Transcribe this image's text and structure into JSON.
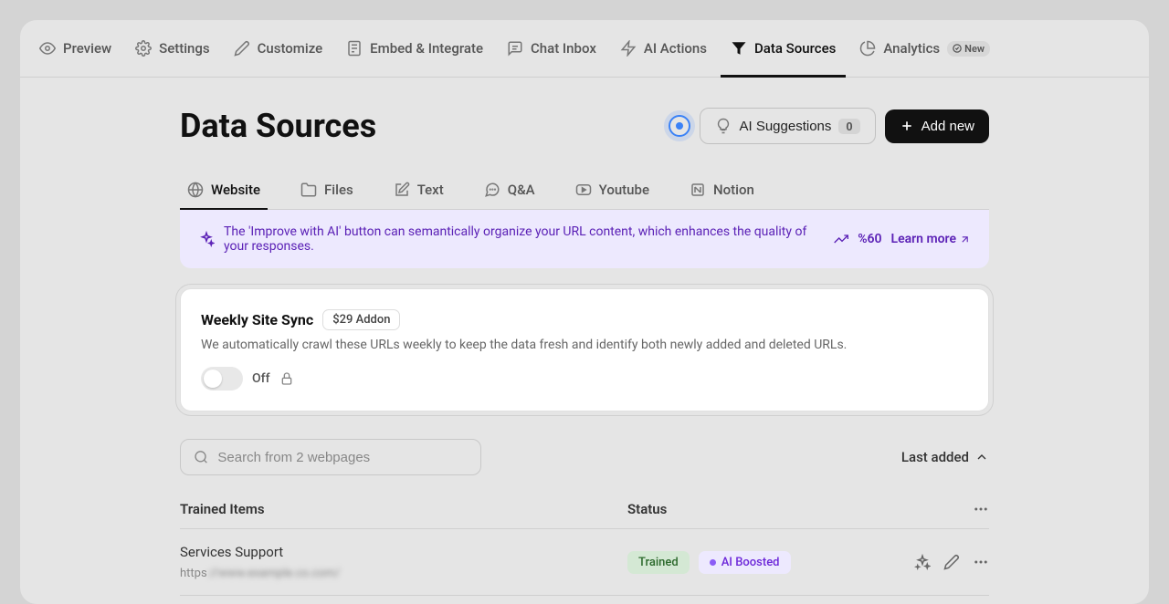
{
  "nav": {
    "preview": "Preview",
    "settings": "Settings",
    "customize": "Customize",
    "embed": "Embed & Integrate",
    "chat": "Chat Inbox",
    "ai_actions": "AI Actions",
    "data_sources": "Data Sources",
    "analytics": "Analytics",
    "new_badge": "New"
  },
  "header": {
    "title": "Data Sources",
    "ai_suggestions": "AI Suggestions",
    "ai_suggestions_count": "0",
    "add_new": "Add new"
  },
  "tabs": {
    "website": "Website",
    "files": "Files",
    "text": "Text",
    "qa": "Q&A",
    "youtube": "Youtube",
    "notion": "Notion"
  },
  "banner": {
    "text": "The 'Improve with AI' button can semantically organize your URL content, which enhances the quality of your responses.",
    "pct": "%60",
    "learn_more": "Learn more"
  },
  "addon": {
    "title": "Weekly Site Sync",
    "badge": "$29 Addon",
    "desc": "We automatically crawl these URLs weekly to keep the data fresh and identify both newly added and deleted URLs.",
    "toggle_label": "Off"
  },
  "search": {
    "placeholder": "Search from 2 webpages"
  },
  "sort": {
    "label": "Last added"
  },
  "table": {
    "col_items": "Trained Items",
    "col_status": "Status",
    "row1": {
      "title": "Services Support",
      "url_prefix": "https",
      "url_rest": "://www.example.co.com/",
      "status_trained": "Trained",
      "status_boosted": "AI Boosted"
    }
  }
}
